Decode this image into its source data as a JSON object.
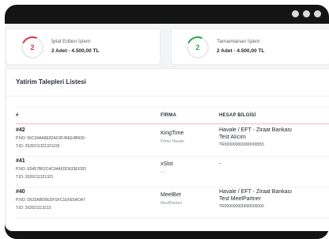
{
  "stats": [
    {
      "value": "2",
      "title": "İptal Edilen İşlem",
      "summary": "2 Adet - 4.500,00 TL",
      "color": "#dc3545"
    },
    {
      "value": "2",
      "title": "Tamamlanan İşlem",
      "summary": "2 Adet - 4.500,00 TL",
      "color": "#28a745"
    }
  ],
  "panel": {
    "title": "Yatirim Talepleri Listesi",
    "columns": {
      "id": "#",
      "firma": "FİRMA",
      "hesap": "HESAP BİLGİSİ"
    }
  },
  "rows": [
    {
      "id": "#42",
      "pno": "P.NO: 56C34AA8E82AC6F45EE4B630",
      "tid": "T.ID: 2626211321321155",
      "firma": "KingTime",
      "firma_sub": "Prime Havale",
      "hesap1": "Havale / EFT - Ziraat Bankası",
      "hesap2": "Test Alıcım",
      "hesap3": "TR000000000000000555"
    },
    {
      "id": "#41",
      "pno": "P.NO: E5457B62C4C04AFDD633EFDD",
      "tid": "T.ID: 2626211321321",
      "firma": "xSlot",
      "firma_sub": "—",
      "hesap1": "-",
      "hesap2": "",
      "hesap3": ""
    },
    {
      "id": "#40",
      "pno": "P.NO: D615ABD0EDFSFC1EFE5AOA7",
      "tid": "T.ID: 262621113213",
      "firma": "MeelBet",
      "firma_sub": "MeelPartner",
      "hesap1": "Havale / EFT - Ziraat Bankası",
      "hesap2": "Test MeelPartner",
      "hesap3": "TR000000000000000000"
    }
  ]
}
